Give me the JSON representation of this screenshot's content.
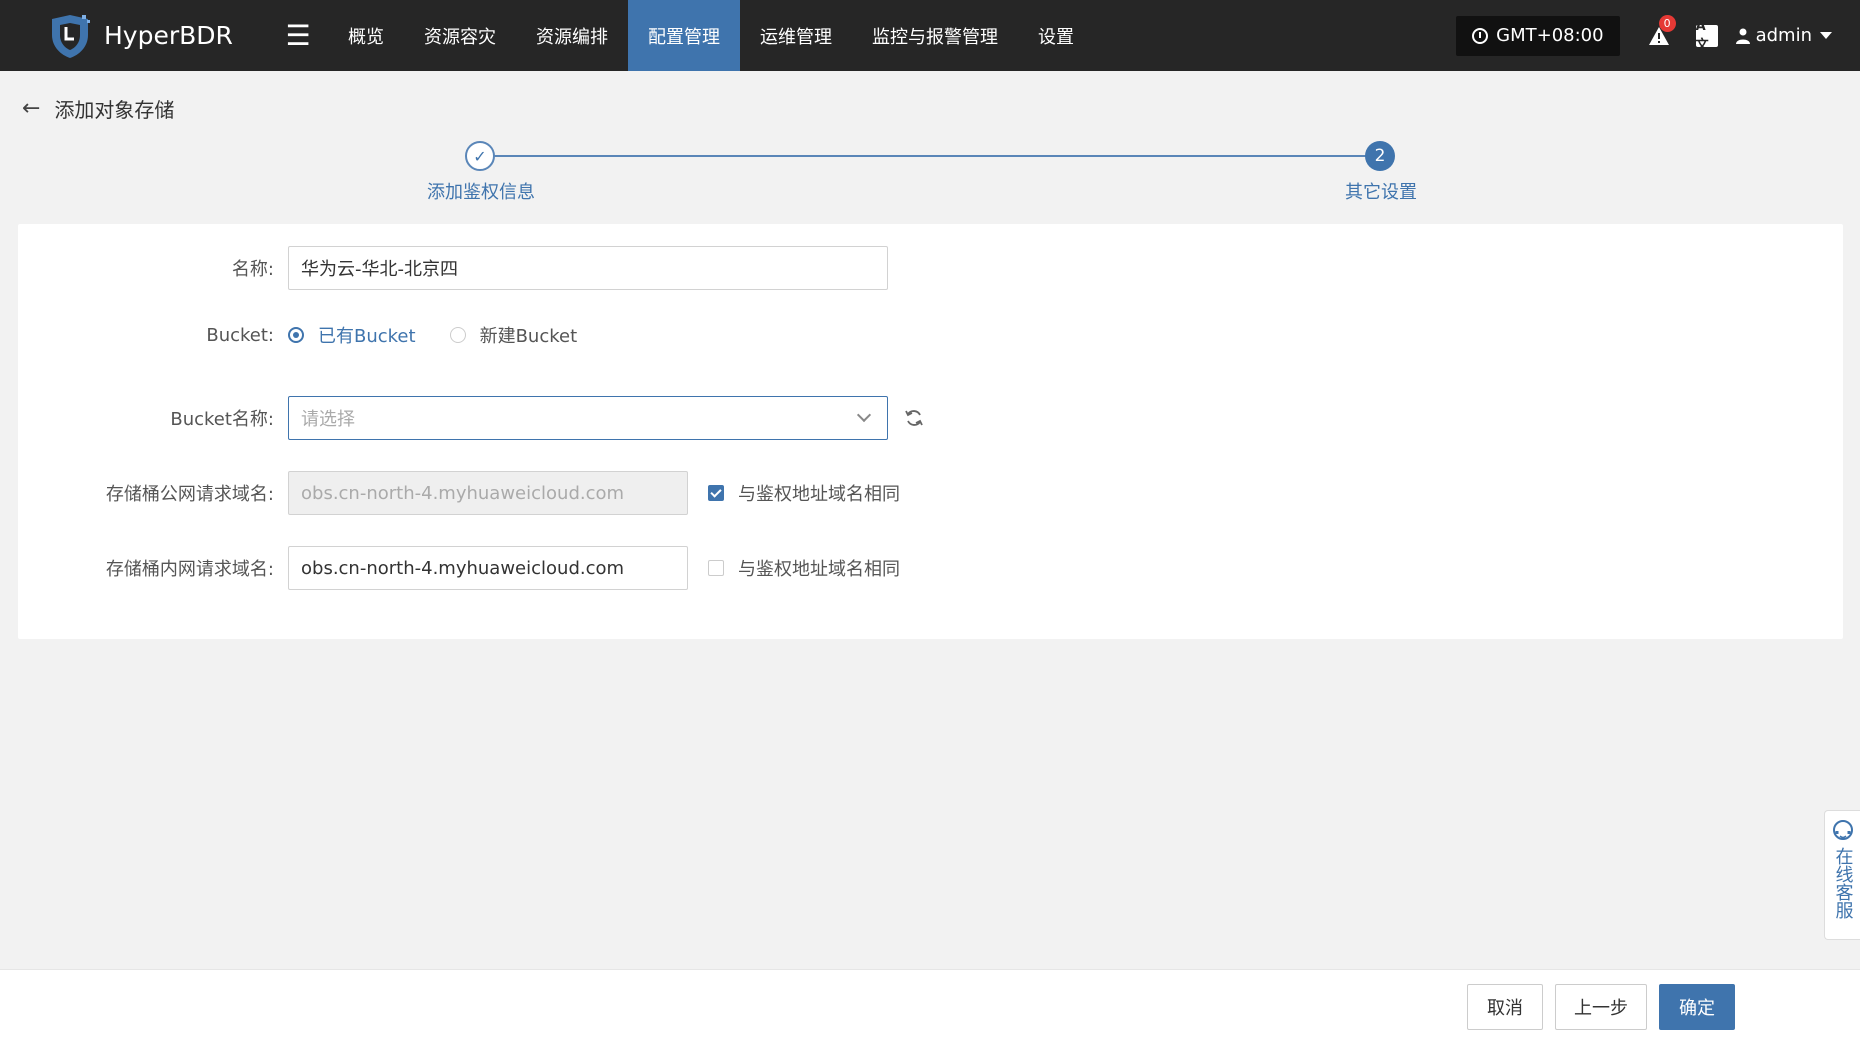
{
  "app": {
    "brand": "HyperBDR"
  },
  "nav": {
    "items": [
      {
        "label": "概览"
      },
      {
        "label": "资源容灾"
      },
      {
        "label": "资源编排"
      },
      {
        "label": "配置管理"
      },
      {
        "label": "运维管理"
      },
      {
        "label": "监控与报警管理"
      },
      {
        "label": "设置"
      }
    ],
    "active_index": 3
  },
  "toolbar": {
    "timezone": "GMT+08:00",
    "alert_count": "0",
    "lang_label": "A文",
    "user": "admin"
  },
  "page": {
    "title": "添加对象存储"
  },
  "steps": {
    "step1": "添加鉴权信息",
    "step2_number": "2",
    "step2": "其它设置"
  },
  "form": {
    "name": {
      "label": "名称:",
      "value": "华为云-华北-北京四"
    },
    "bucket": {
      "label": "Bucket:",
      "option_existing": "已有Bucket",
      "option_new": "新建Bucket"
    },
    "bucket_name": {
      "label": "Bucket名称:",
      "placeholder": "请选择"
    },
    "public_domain": {
      "label": "存储桶公网请求域名:",
      "value": "obs.cn-north-4.myhuaweicloud.com",
      "same_label": "与鉴权地址域名相同"
    },
    "internal_domain": {
      "label": "存储桶内网请求域名:",
      "value": "obs.cn-north-4.myhuaweicloud.com",
      "same_label": "与鉴权地址域名相同"
    }
  },
  "footer": {
    "cancel": "取消",
    "prev": "上一步",
    "confirm": "确定"
  },
  "service": {
    "label": "在线客服"
  },
  "colors": {
    "accent": "#3f74ad",
    "topbar": "#262626",
    "alert": "#e53935"
  }
}
